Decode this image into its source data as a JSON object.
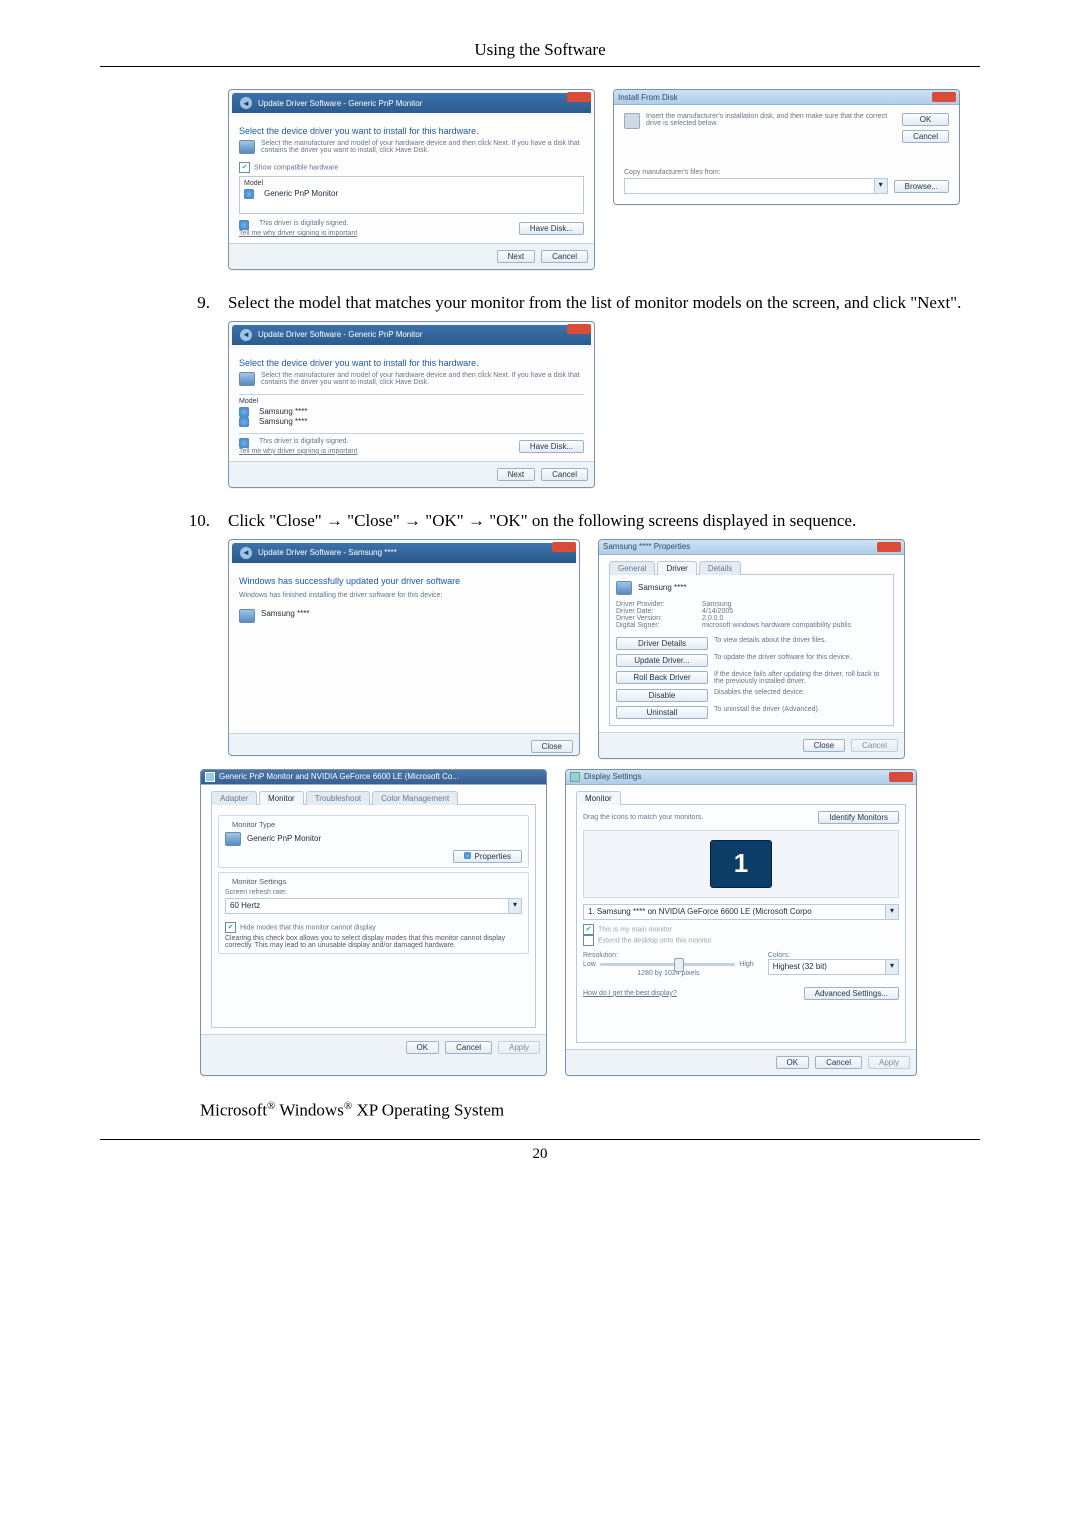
{
  "page": {
    "header": "Using the Software",
    "number": "20",
    "os_line_prefix": "Microsoft",
    "os_line_mid1": " Windows",
    "os_line_suffix": " XP Operating System",
    "reg": "®"
  },
  "step9": {
    "num": "9.",
    "text": "Select the model that matches your monitor from the list of monitor models on the screen, and click \"Next\"."
  },
  "step10": {
    "num": "10.",
    "text": "Click \"Close\" → \"Close\" → \"OK\" → \"OK\" on the following screens displayed in sequence."
  },
  "win_update1": {
    "breadcrumb": "Update Driver Software - Generic PnP Monitor",
    "title": "Select the device driver you want to install for this hardware.",
    "hint": "Select the manufacturer and model of your hardware device and then click Next. If you have a disk that contains the driver you want to install, click Have Disk.",
    "show_compat": "Show compatible hardware",
    "col_model": "Model",
    "model1": "Generic PnP Monitor",
    "signed": "This driver is digitally signed.",
    "why_link": "Tell me why driver signing is important",
    "have_disk": "Have Disk...",
    "next": "Next",
    "cancel": "Cancel"
  },
  "win_install_disk": {
    "title": "Install From Disk",
    "hint": "Insert the manufacturer's installation disk, and then make sure that the correct drive is selected below.",
    "ok": "OK",
    "cancel": "Cancel",
    "copy_label": "Copy manufacturer's files from:",
    "browse": "Browse..."
  },
  "win_update2": {
    "breadcrumb": "Update Driver Software - Generic PnP Monitor",
    "title": "Select the device driver you want to install for this hardware.",
    "hint": "Select the manufacturer and model of your hardware device and then click Next. If you have a disk that contains the driver you want to install, click Have Disk.",
    "col_model": "Model",
    "model_a": "Samsung ****",
    "model_b": "Samsung ****",
    "signed": "This driver is digitally signed.",
    "why_link": "Tell me why driver signing is important",
    "have_disk": "Have Disk...",
    "next": "Next",
    "cancel": "Cancel"
  },
  "win_updated": {
    "breadcrumb": "Update Driver Software - Samsung ****",
    "title": "Windows has successfully updated your driver software",
    "sub": "Windows has finished installing the driver software for this device:",
    "device": "Samsung ****",
    "close": "Close"
  },
  "win_props": {
    "title": "Samsung **** Properties",
    "tab_general": "General",
    "tab_driver": "Driver",
    "tab_details": "Details",
    "device": "Samsung ****",
    "lbl_provider": "Driver Provider:",
    "val_provider": "Samsung",
    "lbl_date": "Driver Date:",
    "val_date": "4/14/2005",
    "lbl_version": "Driver Version:",
    "val_version": "2.0.0.0",
    "lbl_signer": "Digital Signer:",
    "val_signer": "microsoft windows hardware compatibility publis",
    "b_details": "Driver Details",
    "t_details": "To view details about the driver files.",
    "b_update": "Update Driver...",
    "t_update": "To update the driver software for this device.",
    "b_roll": "Roll Back Driver",
    "t_roll": "If the device fails after updating the driver, roll back to the previously installed driver.",
    "b_disable": "Disable",
    "t_disable": "Disables the selected device.",
    "b_uninstall": "Uninstall",
    "t_uninstall": "To uninstall the driver (Advanced).",
    "close": "Close",
    "cancel": "Cancel"
  },
  "win_genprop": {
    "title": "Generic PnP Monitor and NVIDIA GeForce 6600 LE (Microsoft Co...",
    "tab_adapter": "Adapter",
    "tab_monitor": "Monitor",
    "tab_trouble": "Troubleshoot",
    "tab_color": "Color Management",
    "grp_type": "Monitor Type",
    "mon_name": "Generic PnP Monitor",
    "properties": "Properties",
    "grp_settings": "Monitor Settings",
    "lbl_refresh": "Screen refresh rate:",
    "refresh_val": "60 Hertz",
    "chk_hide": "Hide modes that this monitor cannot display",
    "hide_desc": "Clearing this check box allows you to select display modes that this monitor cannot display correctly. This may lead to an unusable display and/or damaged hardware.",
    "ok": "OK",
    "cancel": "Cancel",
    "apply": "Apply"
  },
  "win_display": {
    "title": "Display Settings",
    "tab_monitor": "Monitor",
    "drag": "Drag the icons to match your monitors.",
    "identify": "Identify Monitors",
    "mon_num": "1",
    "sel_label": "1. Samsung **** on NVIDIA GeForce 6600 LE (Microsoft Corpo",
    "chk_main": "This is my main monitor",
    "chk_extend": "Extend the desktop onto this monitor",
    "lbl_res": "Resolution:",
    "lbl_colors": "Colors:",
    "res_lo": "Low",
    "res_hi": "High",
    "res_val": "1280 by 1024 pixels",
    "colors_val": "Highest (32 bit)",
    "best_link": "How do I get the best display?",
    "adv": "Advanced Settings...",
    "ok": "OK",
    "cancel": "Cancel",
    "apply": "Apply"
  }
}
